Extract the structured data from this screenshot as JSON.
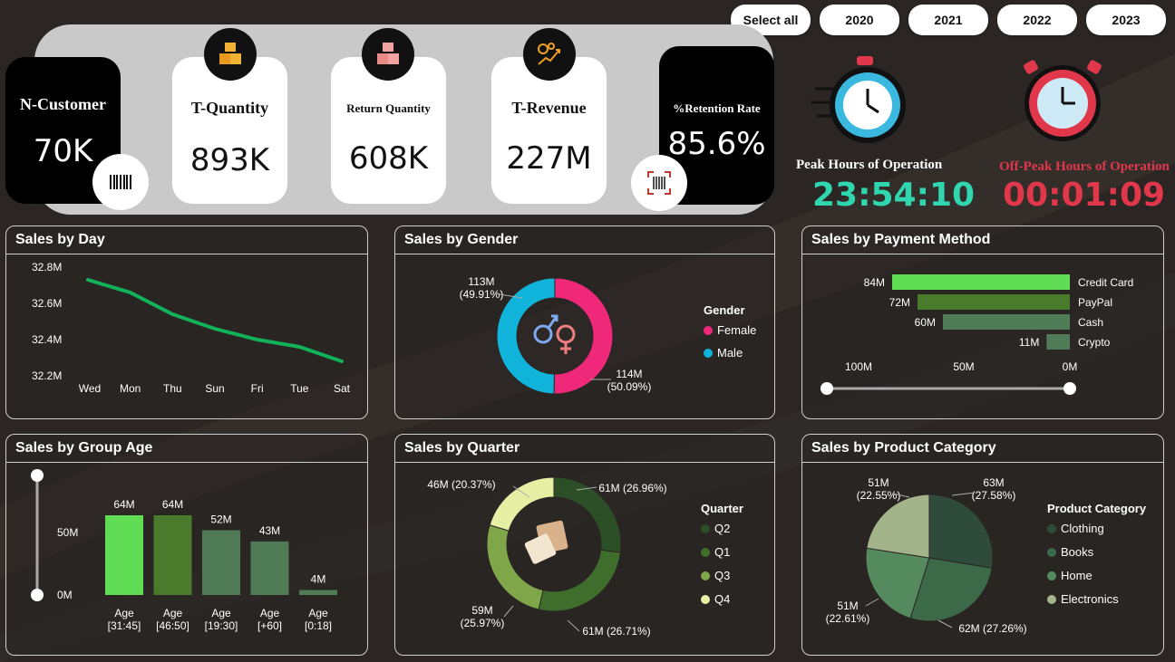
{
  "filters": {
    "years": [
      "Select all",
      "2020",
      "2021",
      "2022",
      "2023"
    ]
  },
  "kpis": {
    "customers": {
      "label": "N-Customer",
      "value": "70K"
    },
    "quantity": {
      "label": "T-Quantity",
      "value": "893K"
    },
    "returns": {
      "label": "Return Quantity",
      "value": "608K"
    },
    "revenue": {
      "label": "T-Revenue",
      "value": "227M"
    },
    "retention": {
      "label": "%Retention Rate",
      "value": "85.6%"
    }
  },
  "hours": {
    "peak": {
      "label": "Peak Hours of Operation",
      "value": "23:54:10"
    },
    "offpeak": {
      "label": "Off-Peak Hours of Operation",
      "value": "00:01:09"
    }
  },
  "colors": {
    "teal": "#2fd6b0",
    "red": "#e0374a",
    "pink": "#f0287a",
    "cyan": "#10b4da",
    "green_line": "#11b25a"
  },
  "panels": {
    "day": "Sales by Day",
    "gender": "Sales by Gender",
    "payment": "Sales by Payment Method",
    "age": "Sales by Group Age",
    "quarter": "Sales by Quarter",
    "product": "Sales by Product Category"
  },
  "chart_data": [
    {
      "id": "day",
      "type": "line",
      "title": "Sales by Day",
      "categories": [
        "Wed",
        "Mon",
        "Thu",
        "Sun",
        "Fri",
        "Tue",
        "Sat"
      ],
      "values": [
        32.73,
        32.66,
        32.54,
        32.46,
        32.4,
        32.36,
        32.28
      ],
      "ytick_labels": [
        "32.8M",
        "32.6M",
        "32.4M",
        "32.2M"
      ],
      "ylim": [
        32.2,
        32.8
      ],
      "color": "#11b25a"
    },
    {
      "id": "gender",
      "type": "pie",
      "title": "Sales by Gender",
      "legend_title": "Gender",
      "categories": [
        "Female",
        "Male"
      ],
      "values": [
        114,
        113
      ],
      "labels": [
        "114M\n(50.09%)",
        "113M\n(49.91%)"
      ],
      "colors": [
        "#f0287a",
        "#10b4da"
      ]
    },
    {
      "id": "payment",
      "type": "bar",
      "title": "Sales by Payment Method",
      "categories": [
        "Credit Card",
        "PayPal",
        "Cash",
        "Crypto"
      ],
      "values": [
        84,
        72,
        60,
        11
      ],
      "labels": [
        "84M",
        "72M",
        "60M",
        "11M"
      ],
      "xtick_labels": [
        "100M",
        "50M",
        "0M"
      ],
      "colors": [
        "#5fdc54",
        "#4a7a2c",
        "#4f7c57",
        "#4f7c57"
      ]
    },
    {
      "id": "age",
      "type": "bar",
      "title": "Sales by Group Age",
      "categories": [
        "Age\n[31:45]",
        "Age\n[46:50]",
        "Age\n[19:30]",
        "Age\n[+60]",
        "Age\n[0:18]"
      ],
      "values": [
        64,
        64,
        52,
        43,
        4
      ],
      "labels": [
        "64M",
        "64M",
        "52M",
        "43M",
        "4M"
      ],
      "ytick_labels": [
        "50M",
        "0M"
      ],
      "colors": [
        "#5fdc54",
        "#4a7a2c",
        "#4f7c57",
        "#4f7c57",
        "#4f7c57"
      ]
    },
    {
      "id": "quarter",
      "type": "pie",
      "title": "Sales by Quarter",
      "legend_title": "Quarter",
      "categories": [
        "Q2",
        "Q1",
        "Q3",
        "Q4"
      ],
      "values": [
        26.96,
        26.71,
        25.97,
        20.37
      ],
      "labels": [
        "61M (26.96%)",
        "61M (26.71%)",
        "59M\n(25.97%)",
        "46M (20.37%)"
      ],
      "colors": [
        "#2d4f27",
        "#3f6d2b",
        "#80a64a",
        "#e6f0a4"
      ]
    },
    {
      "id": "product",
      "type": "pie",
      "title": "Sales by Product Category",
      "legend_title": "Product Category",
      "categories": [
        "Clothing",
        "Books",
        "Home",
        "Electronics"
      ],
      "values": [
        27.58,
        27.26,
        22.61,
        22.55
      ],
      "labels": [
        "63M\n(27.58%)",
        "62M (27.26%)",
        "51M\n(22.61%)",
        "51M\n(22.55%)"
      ],
      "colors": [
        "#2f4b3c",
        "#3c6a48",
        "#558a5e",
        "#a3b48a"
      ]
    }
  ]
}
